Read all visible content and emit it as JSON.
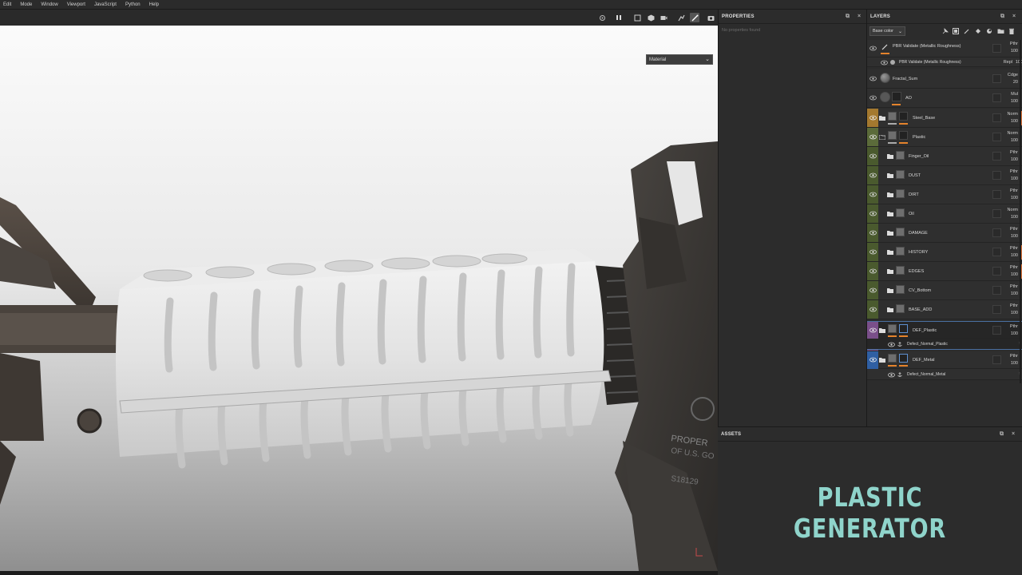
{
  "menu": [
    "Edit",
    "Mode",
    "Window",
    "Viewport",
    "JavaScript",
    "Python",
    "Help"
  ],
  "viewport": {
    "channel": "Material",
    "toolbar_icons": [
      "target-icon",
      "pause-icon",
      "frame-icon",
      "cube-icon",
      "camera-icon",
      "light-icon",
      "brush-icon",
      "snapshot-icon"
    ]
  },
  "properties": {
    "title": "PROPERTIES",
    "empty_text": "No properties found"
  },
  "layers": {
    "title": "LAYERS",
    "channel": "Base color",
    "toolbar_icons": [
      "pin-icon",
      "mask-add-icon",
      "paint-layer-icon",
      "fill-layer-icon",
      "effect-icon",
      "folder-icon",
      "delete-icon"
    ],
    "rows": [
      {
        "name": "PBR Validate (Metallic Roughness)",
        "blend": "Pthr",
        "opacity": "100",
        "kind": "filter"
      },
      {
        "name": "PBR Validate (Metallic Roughness)",
        "blend": "Repl",
        "opacity": "100",
        "kind": "effect"
      },
      {
        "name": "Fractal_Sum",
        "blend": "Cdge",
        "opacity": "20",
        "kind": "layer"
      },
      {
        "name": "AO",
        "blend": "Mul",
        "opacity": "100",
        "kind": "layer-mask"
      },
      {
        "name": "Steel_Base",
        "blend": "Norm",
        "opacity": "100",
        "kind": "folder-mask"
      },
      {
        "name": "Plastic",
        "blend": "Norm",
        "opacity": "100",
        "kind": "folder-mask"
      },
      {
        "name": "Finger_Oil",
        "blend": "Pthr",
        "opacity": "100",
        "kind": "folder"
      },
      {
        "name": "DUST",
        "blend": "Pthr",
        "opacity": "100",
        "kind": "folder"
      },
      {
        "name": "DIRT",
        "blend": "Pthr",
        "opacity": "100",
        "kind": "folder"
      },
      {
        "name": "Oil",
        "blend": "Norm",
        "opacity": "100",
        "kind": "folder"
      },
      {
        "name": "DAMAGE",
        "blend": "Pthr",
        "opacity": "100",
        "kind": "folder"
      },
      {
        "name": "HISTORY",
        "blend": "Pthr",
        "opacity": "100",
        "kind": "folder"
      },
      {
        "name": "EDGES",
        "blend": "Pthr",
        "opacity": "100",
        "kind": "folder"
      },
      {
        "name": "CV_Bottom",
        "blend": "Pthr",
        "opacity": "100",
        "kind": "folder"
      },
      {
        "name": "BASE_ADD",
        "blend": "Pthr",
        "opacity": "100",
        "kind": "folder"
      },
      {
        "name": "DEF_Plastic",
        "blend": "Pthr",
        "opacity": "100",
        "kind": "folder-mask"
      },
      {
        "name": "Defect_Normal_Plastic",
        "kind": "anchor"
      },
      {
        "name": "DEF_Metal",
        "blend": "Pthr",
        "opacity": "100",
        "kind": "folder-mask"
      },
      {
        "name": "Defect_Normal_Metal",
        "kind": "anchor"
      }
    ],
    "colors": {
      "steel_base": "#a4792f",
      "plastic": "#5b6b3a",
      "green_group": "#4a5a2e",
      "def_plastic": "#7a4f8a",
      "def_metal": "#2f5fa3",
      "accent_orange": "#e4832c"
    }
  },
  "assets": {
    "title": "ASSETS",
    "overlay_title": "PLASTIC GENERATOR",
    "overlay_color": "#8fd4cb"
  }
}
